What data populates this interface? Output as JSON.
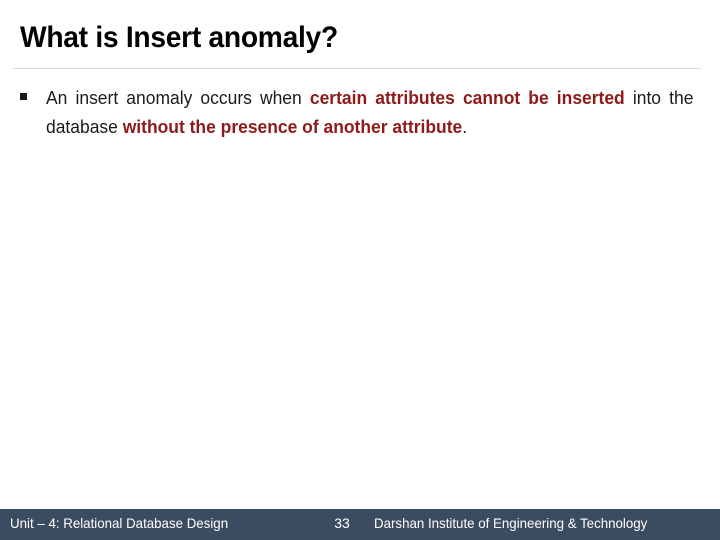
{
  "slide": {
    "title": "What is Insert anomaly?",
    "background_color": "#ffffff",
    "rule_color": "#d9d9d9"
  },
  "body": {
    "bullet_glyph": "§",
    "highlight_color": "#8f1a1a",
    "text_color": "#1a1a1a",
    "bullet_items": [
      {
        "segments": [
          {
            "text": "An insert anomaly occurs when ",
            "emphasis": false
          },
          {
            "text": "certain attributes cannot be inserted",
            "emphasis": true
          },
          {
            "text": " into the database ",
            "emphasis": false
          },
          {
            "text": "without the presence of another attribute",
            "emphasis": true
          },
          {
            "text": ".",
            "emphasis": false
          }
        ]
      }
    ]
  },
  "footer": {
    "background_color": "#3c4c60",
    "text_color": "#ffffff",
    "left_label": "Unit – 4: Relational Database Design",
    "page_number": "33",
    "right_label": "Darshan Institute of Engineering & Technology"
  }
}
